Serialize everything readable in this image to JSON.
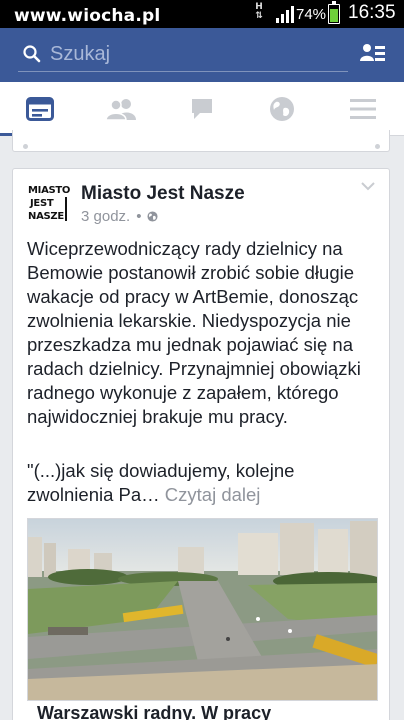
{
  "status_bar": {
    "watermark": "www.wiocha.pl",
    "network_type": "H",
    "battery_percent": "74%",
    "battery_level": 0.74,
    "time": "16:35"
  },
  "header": {
    "search_placeholder": "Szukaj",
    "search_icon": "search-icon",
    "friend_requests_icon": "friend-requests-icon",
    "color": "#3b5998"
  },
  "tabs": [
    {
      "id": "news-feed",
      "icon": "news-feed-icon",
      "active": true
    },
    {
      "id": "friends",
      "icon": "friends-icon",
      "active": false
    },
    {
      "id": "messages",
      "icon": "messages-icon",
      "active": false
    },
    {
      "id": "notifications",
      "icon": "globe-icon",
      "active": false
    },
    {
      "id": "more",
      "icon": "menu-icon",
      "active": false
    }
  ],
  "post": {
    "avatar_logo": [
      "MIASTO",
      "JEST",
      "NASZE"
    ],
    "page_name": "Miasto Jest Nasze",
    "time": "3 godz.",
    "separator": "•",
    "privacy_icon": "globe-icon",
    "text": "Wiceprzewodniczący rady dzielnicy na Bemowie postanowił zrobić sobie długie wakacje od pracy w ArtBemie, donosząc zwolnienia lekarskie. Niedyspozycja nie przeszkadza mu jednak pojawiać się na radach dzielnicy. Przynajmniej obowiązki radnego wykonuje z zapałem, którego najwidoczniej brakuje mu pracy.",
    "quote": "\"(...)jak się dowiadujemy, kolejne zwolnienia Pa…",
    "read_more": "Czytaj dalej",
    "link_title": "Warszawski radny. W pracy"
  }
}
